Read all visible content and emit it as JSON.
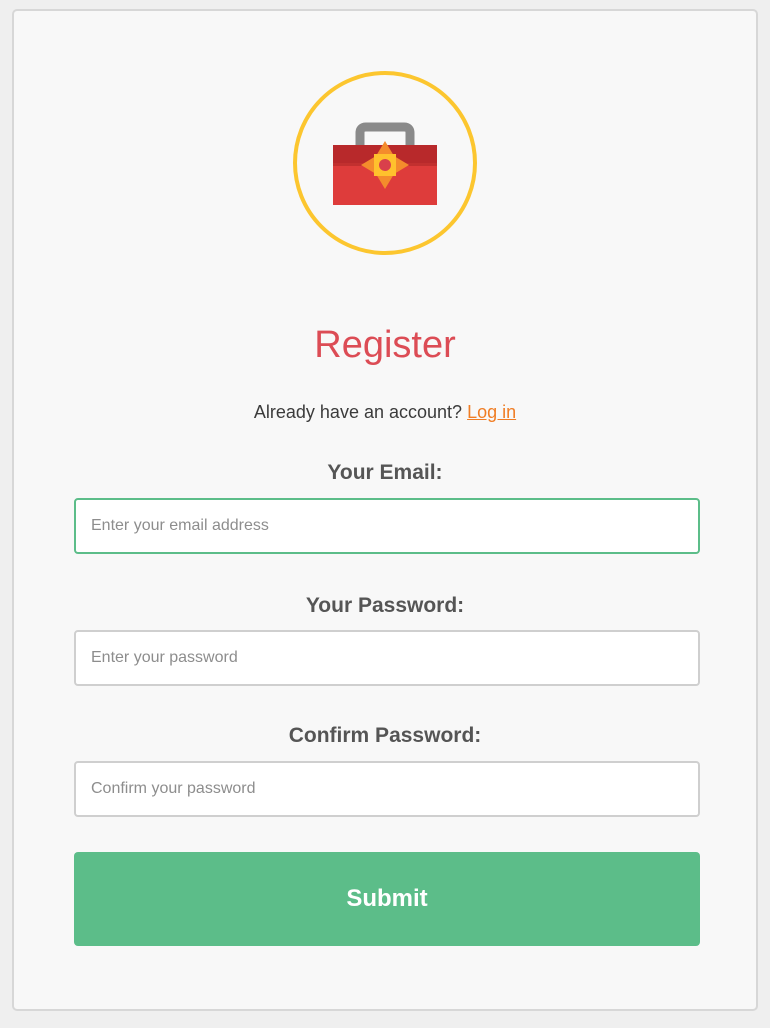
{
  "logo": {
    "icon": "toolbox-icon",
    "ring_color": "#fcc62f",
    "box_color": "#de3c3b",
    "handle_color": "#8a8a8a"
  },
  "form": {
    "title": "Register",
    "account_prompt": "Already have an account?",
    "login_link": "Log in",
    "email": {
      "label": "Your Email:",
      "placeholder": "Enter your email address",
      "value": ""
    },
    "password": {
      "label": "Your Password:",
      "placeholder": "Enter your password",
      "value": ""
    },
    "confirm_password": {
      "label": "Confirm Password:",
      "placeholder": "Confirm your password",
      "value": ""
    },
    "submit_label": "Submit"
  },
  "colors": {
    "title": "#dc4c55",
    "link": "#f07d24",
    "accent": "#5cbd89"
  }
}
